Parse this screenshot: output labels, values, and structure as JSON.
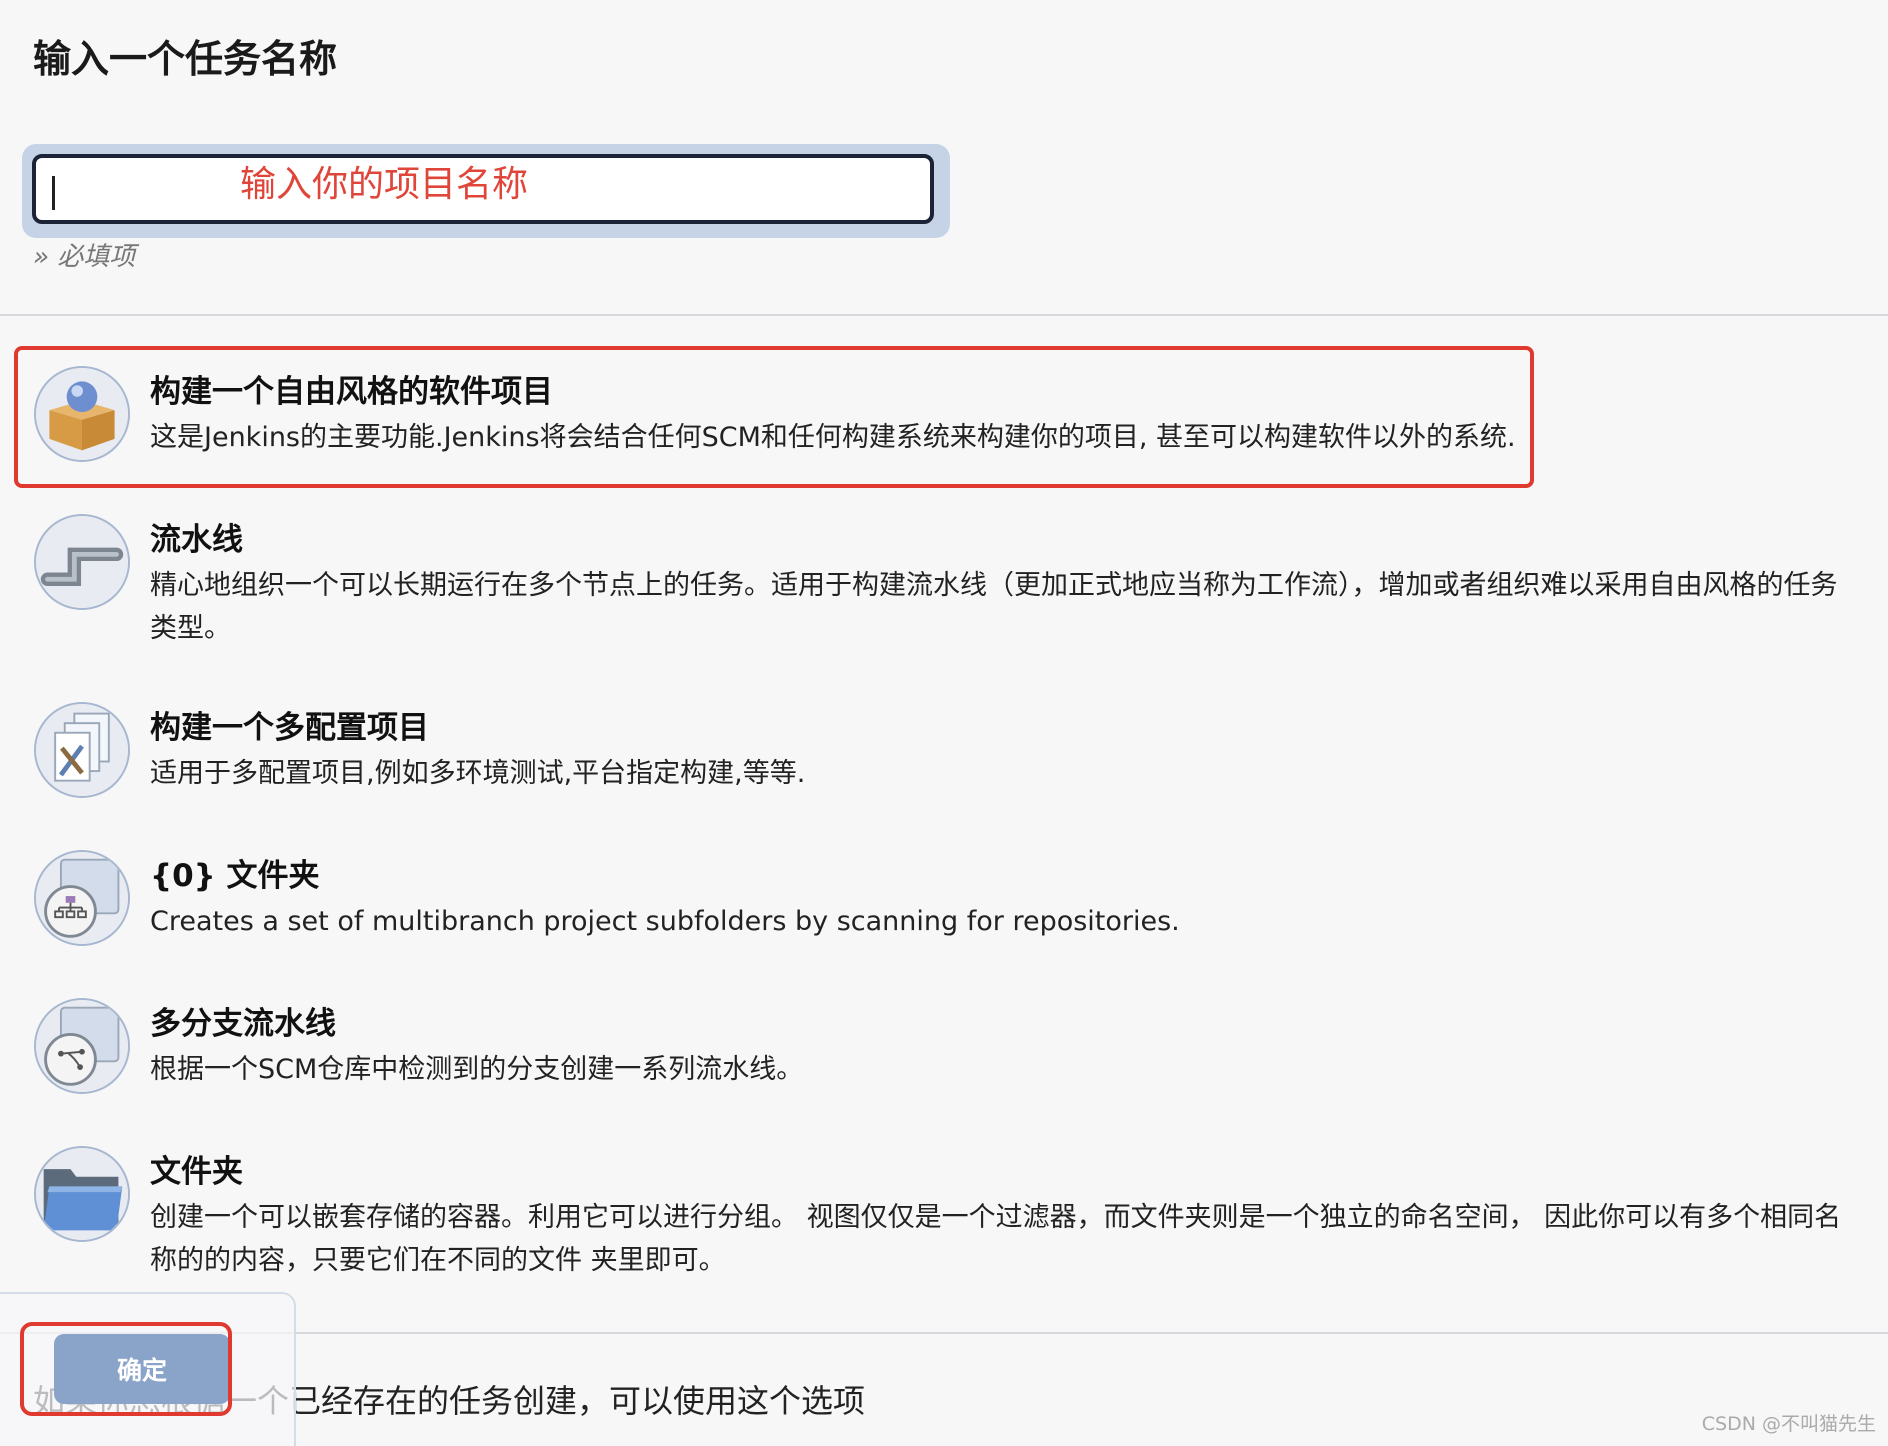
{
  "page": {
    "title": "输入一个任务名称",
    "input_value": "",
    "input_annotation": "输入你的项目名称",
    "required_hint": "» 必填项"
  },
  "items": [
    {
      "title": "构建一个自由风格的软件项目",
      "desc": "这是Jenkins的主要功能.Jenkins将会结合任何SCM和任何构建系统来构建你的项目, 甚至可以构建软件以外的系统.",
      "icon": "freestyle-box-icon"
    },
    {
      "title": "流水线",
      "desc": "精心地组织一个可以长期运行在多个节点上的任务。适用于构建流水线（更加正式地应当称为工作流），增加或者组织难以采用自由风格的任务类型。",
      "icon": "pipeline-icon"
    },
    {
      "title": "构建一个多配置项目",
      "desc": "适用于多配置项目,例如多环境测试,平台指定构建,等等.",
      "icon": "multi-config-icon"
    },
    {
      "title": "{0} 文件夹",
      "desc": "Creates a set of multibranch project subfolders by scanning for repositories.",
      "icon": "org-folder-icon"
    },
    {
      "title": "多分支流水线",
      "desc": "根据一个SCM仓库中检测到的分支创建一系列流水线。",
      "icon": "multibranch-icon"
    },
    {
      "title": "文件夹",
      "desc": "创建一个可以嵌套存储的容器。利用它可以进行分组。 视图仅仅是一个过滤器，而文件夹则是一个独立的命名空间， 因此你可以有多个相同名称的的内容，只要它们在不同的文件 夹里即可。",
      "icon": "folder-icon"
    }
  ],
  "copy_hint": "如果你想根据一个已经存在的任务创建，可以使用这个选项",
  "ok_button": "确定",
  "watermark": "CSDN @不叫猫先生"
}
